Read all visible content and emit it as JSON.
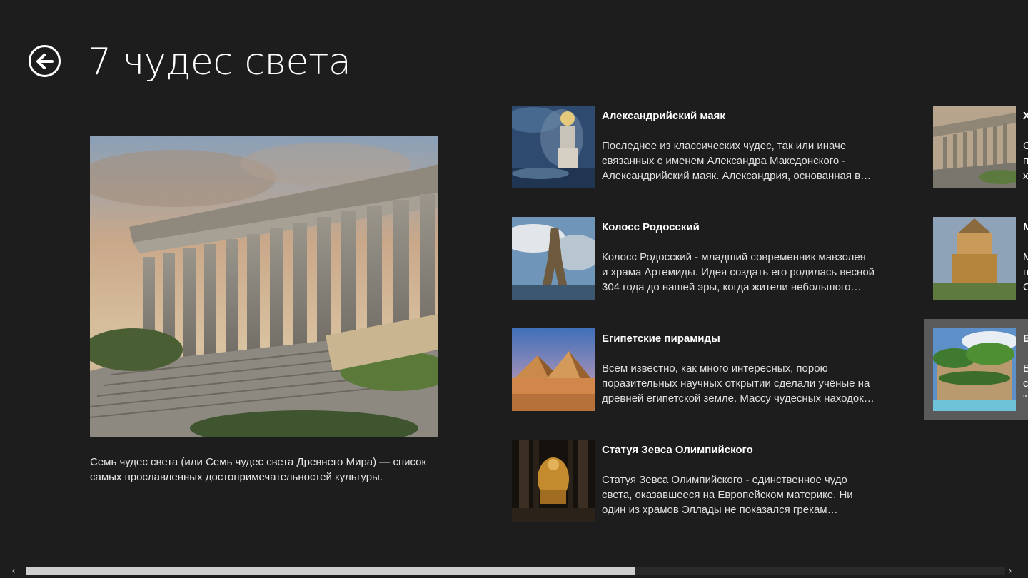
{
  "page": {
    "title": "7 чудес света"
  },
  "hero": {
    "description": "Семь чудес света (или Семь чудес света Древнего Мира) — список самых прославленных достопримечательностей культуры."
  },
  "items": [
    {
      "title": "Александрийский маяк",
      "desc_lines": [
        "Последнее из классических чудес, так или иначе",
        "связанных с именем Александра Македонского -",
        "Александрийский маяк. Александрия, основанная в…"
      ]
    },
    {
      "title": "Колосс Родосский",
      "desc_lines": [
        "Колосс Родосский - младший современник мавзолея",
        "и храма Артемиды. Идея создать его родилась весной",
        "304 года до нашей эры, когда жители небольшого…"
      ]
    },
    {
      "title": "Египетские пирамиды",
      "desc_lines": [
        "Всем известно, как много интересных, порою",
        "поразительных научных открытии сделали учёные на",
        "древней египетской земле. Массу чудесных находок…"
      ]
    },
    {
      "title": "Статуя Зевса Олимпийского",
      "desc_lines": [
        "Статуя Зевса Олимпийского - единственное чудо",
        "света, оказавшееся на Европейском материке. Ни",
        "один из храмов Эллады не показался грекам…"
      ]
    }
  ],
  "right_items": [
    {
      "title": "Х",
      "desc_lines": [
        "С",
        "п",
        "х"
      ]
    },
    {
      "title": "М",
      "desc_lines": [
        "М",
        "п",
        "С"
      ]
    },
    {
      "title": "В",
      "desc_lines": [
        "В",
        "с",
        "\""
      ]
    }
  ],
  "scrollbar": {
    "left_arrow": "‹",
    "right_arrow": "›",
    "position_fraction": 0.59
  },
  "colors": {
    "background": "#1d1d1d",
    "selected_tile": "#5a5a5a",
    "scroll_thumb": "#cfcfcf"
  }
}
